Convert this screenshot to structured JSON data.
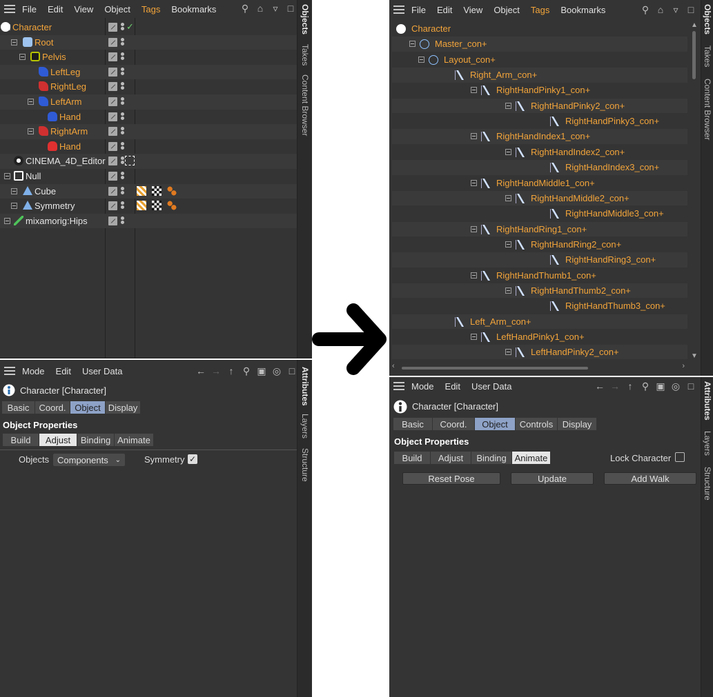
{
  "left": {
    "menu": {
      "file": "File",
      "edit": "Edit",
      "view": "View",
      "object": "Object",
      "tags": "Tags",
      "bookmarks": "Bookmarks"
    },
    "side_tabs": {
      "objects": "Objects",
      "takes": "Takes",
      "content_browser": "Content Browser"
    },
    "tree": [
      {
        "label": "Character",
        "selected": true
      },
      {
        "label": "Root"
      },
      {
        "label": "Pelvis"
      },
      {
        "label": "LeftLeg"
      },
      {
        "label": "RightLeg"
      },
      {
        "label": "LeftArm"
      },
      {
        "label": "Hand"
      },
      {
        "label": "RightArm"
      },
      {
        "label": "Hand"
      },
      {
        "label": "CINEMA_4D_Editor"
      },
      {
        "label": "Null"
      },
      {
        "label": "Cube"
      },
      {
        "label": "Symmetry"
      },
      {
        "label": "mixamorig:Hips"
      }
    ],
    "attr": {
      "menu": {
        "mode": "Mode",
        "edit": "Edit",
        "user_data": "User Data"
      },
      "title": "Character [Character]",
      "tabs": [
        "Basic",
        "Coord.",
        "Object",
        "Display"
      ],
      "section": "Object Properties",
      "subtabs": [
        "Build",
        "Adjust",
        "Binding",
        "Animate"
      ],
      "objects_label": "Objects",
      "objects_value": "Components",
      "symmetry_label": "Symmetry"
    },
    "attr_side_tabs": {
      "attributes": "Attributes",
      "layers": "Layers",
      "structure": "Structure"
    }
  },
  "right": {
    "menu": {
      "file": "File",
      "edit": "Edit",
      "view": "View",
      "object": "Object",
      "tags": "Tags",
      "bookmarks": "Bookmarks"
    },
    "side_tabs": {
      "objects": "Objects",
      "takes": "Takes",
      "content_browser": "Content Browser"
    },
    "tree": [
      {
        "label": "Character"
      },
      {
        "label": "Master_con+"
      },
      {
        "label": "Layout_con+"
      },
      {
        "label": "Right_Arm_con+"
      },
      {
        "label": "RightHandPinky1_con+"
      },
      {
        "label": "RightHandPinky2_con+"
      },
      {
        "label": "RightHandPinky3_con+"
      },
      {
        "label": "RightHandIndex1_con+"
      },
      {
        "label": "RightHandIndex2_con+"
      },
      {
        "label": "RightHandIndex3_con+"
      },
      {
        "label": "RightHandMiddle1_con+"
      },
      {
        "label": "RightHandMiddle2_con+"
      },
      {
        "label": "RightHandMiddle3_con+"
      },
      {
        "label": "RightHandRing1_con+"
      },
      {
        "label": "RightHandRing2_con+"
      },
      {
        "label": "RightHandRing3_con+"
      },
      {
        "label": "RightHandThumb1_con+"
      },
      {
        "label": "RightHandThumb2_con+"
      },
      {
        "label": "RightHandThumb3_con+"
      },
      {
        "label": "Left_Arm_con+"
      },
      {
        "label": "LeftHandPinky1_con+"
      },
      {
        "label": "LeftHandPinky2_con+"
      }
    ],
    "attr": {
      "menu": {
        "mode": "Mode",
        "edit": "Edit",
        "user_data": "User Data"
      },
      "title": "Character [Character]",
      "tabs": [
        "Basic",
        "Coord.",
        "Object",
        "Controls",
        "Display"
      ],
      "section": "Object Properties",
      "subtabs": [
        "Build",
        "Adjust",
        "Binding",
        "Animate"
      ],
      "lock_label": "Lock Character",
      "buttons": [
        "Reset Pose",
        "Update",
        "Add Walk"
      ]
    },
    "attr_side_tabs": {
      "attributes": "Attributes",
      "layers": "Layers",
      "structure": "Structure"
    }
  },
  "colors": {
    "accent": "#f2a43a",
    "panel": "#343434",
    "tab_selected": "#8ea2c7"
  }
}
